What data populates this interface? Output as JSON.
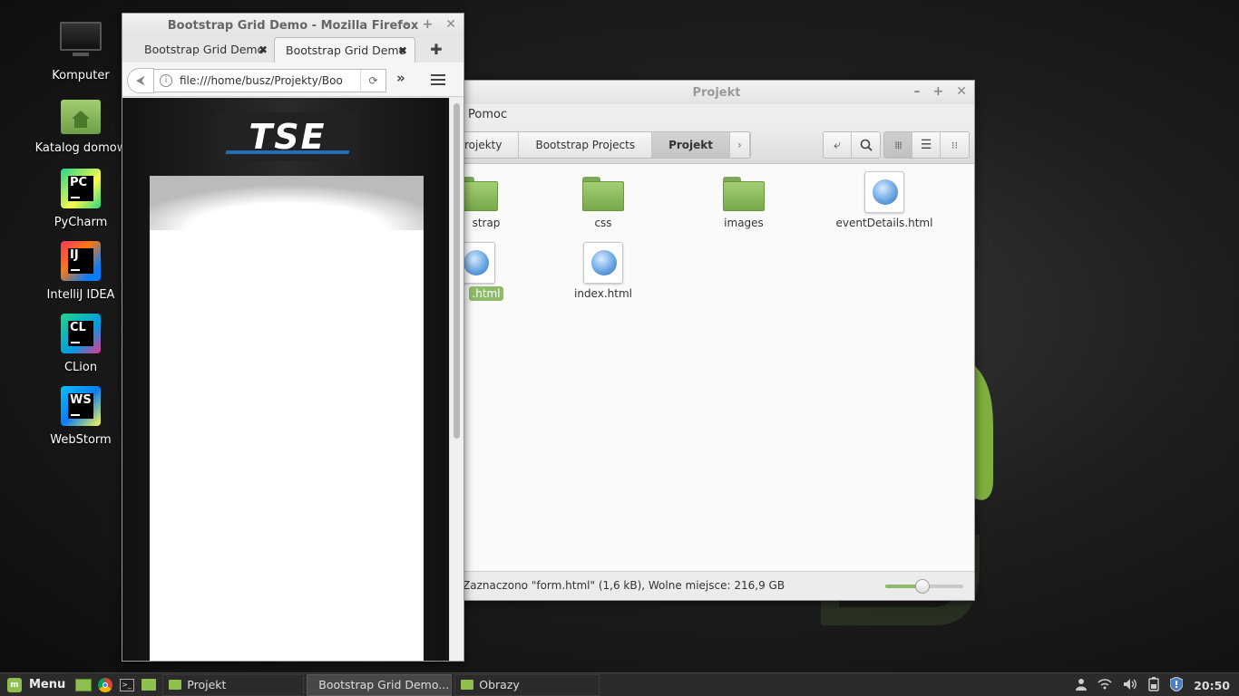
{
  "desktop": {
    "icons": [
      {
        "label": "Komputer",
        "icon": "computer-icon"
      },
      {
        "label": "Katalog domow",
        "icon": "home-folder-icon"
      },
      {
        "label": "PyCharm",
        "icon": "pycharm-icon",
        "abbr": "PC"
      },
      {
        "label": "IntelliJ IDEA",
        "icon": "intellij-icon",
        "abbr": "IJ"
      },
      {
        "label": "CLion",
        "icon": "clion-icon",
        "abbr": "CL"
      },
      {
        "label": "WebStorm",
        "icon": "webstorm-icon",
        "abbr": "WS"
      }
    ]
  },
  "nemo": {
    "title": "Projekt",
    "menu": "Pomoc",
    "breadcrumbs": [
      "rojekty",
      "Bootstrap Projects",
      "Projekt"
    ],
    "breadcrumb_next": "›",
    "files": [
      {
        "name": "strap",
        "type": "folder"
      },
      {
        "name": "css",
        "type": "folder"
      },
      {
        "name": "images",
        "type": "folder"
      },
      {
        "name": "eventDetails.html",
        "type": "html"
      },
      {
        "name": ".html",
        "type": "html",
        "selected": true
      },
      {
        "name": "index.html",
        "type": "html"
      }
    ],
    "status": "Zaznaczono \"form.html\" (1,6 kB), Wolne miejsce: 216,9 GB",
    "zoom_fraction": 0.48
  },
  "firefox": {
    "title": "Bootstrap Grid Demo - Mozilla Firefox",
    "tabs": [
      "Bootstrap Grid Demo",
      "Bootstrap Grid Demo"
    ],
    "url": "file:///home/busz/Projekty/Boo",
    "logo_text": "TSE"
  },
  "taskbar": {
    "menu_label": "Menu",
    "tasks": [
      "Projekt",
      "Bootstrap Grid Demo...",
      "Obrazy"
    ],
    "clock": "20:50"
  },
  "colors": {
    "accent_green": "#8fba6a",
    "taskbar_bg": "#2b2b2b"
  }
}
